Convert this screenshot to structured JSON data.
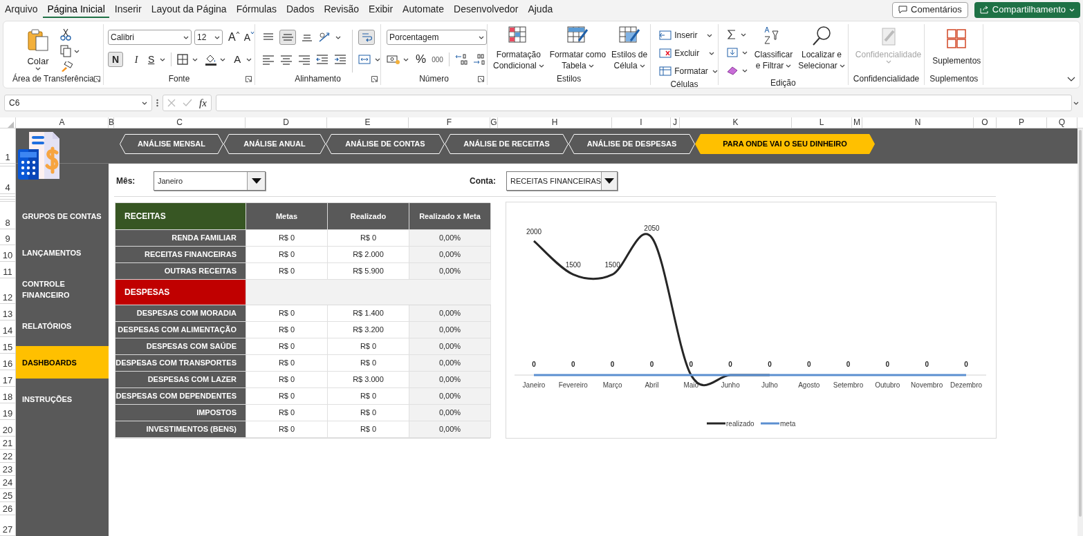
{
  "menu_tabs": [
    {
      "label": "Arquivo",
      "selected": false
    },
    {
      "label": "Página Inicial",
      "selected": true
    },
    {
      "label": "Inserir",
      "selected": false
    },
    {
      "label": "Layout da Página",
      "selected": false
    },
    {
      "label": "Fórmulas",
      "selected": false
    },
    {
      "label": "Dados",
      "selected": false
    },
    {
      "label": "Revisão",
      "selected": false
    },
    {
      "label": "Exibir",
      "selected": false
    },
    {
      "label": "Automate",
      "selected": false
    },
    {
      "label": "Desenvolvedor",
      "selected": false
    },
    {
      "label": "Ajuda",
      "selected": false
    }
  ],
  "header_buttons": {
    "comments": "Comentários",
    "share": "Compartilhamento"
  },
  "ribbon": {
    "clipboard": {
      "label": "Área de Transferência",
      "paste": "Colar"
    },
    "font": {
      "label": "Fonte",
      "family": "Calibri",
      "size": "12",
      "grow": "A",
      "shrink": "A",
      "bold": "N",
      "bold_on": true,
      "italic": "I",
      "underline": "S",
      "font_color": "A"
    },
    "alignment": {
      "label": "Alinhamento",
      "middle_on": true,
      "wrap_on": true
    },
    "number": {
      "label": "Número",
      "format": "Porcentagem",
      "percent": "%",
      "thousands": "000"
    },
    "styles": {
      "label": "Estilos",
      "buttons": [
        {
          "lines": [
            "Formatação",
            "Condicional"
          ]
        },
        {
          "lines": [
            "Formatar como",
            "Tabela"
          ]
        },
        {
          "lines": [
            "Estilos de",
            "Célula"
          ]
        }
      ]
    },
    "cells": {
      "label": "Células",
      "buttons": [
        "Inserir",
        "Excluir",
        "Formatar"
      ]
    },
    "editing": {
      "label": "Edição",
      "buttons": [
        {
          "lines": [
            "Classificar",
            "e Filtrar"
          ]
        },
        {
          "lines": [
            "Localizar e",
            "Selecionar"
          ]
        }
      ]
    },
    "sensitivity": {
      "label": "Confidencialidade",
      "button": "Confidencialidade",
      "disabled": true
    },
    "addins": {
      "label": "Suplementos",
      "button": "Suplementos"
    }
  },
  "formula_bar": {
    "name_box": "C6",
    "function_label": "fx"
  },
  "columns": [
    "A",
    "B",
    "C",
    "D",
    "E",
    "F",
    "G",
    "H",
    "I",
    "J",
    "K",
    "L",
    "M",
    "N",
    "O",
    "P",
    "Q"
  ],
  "rows": [
    "1",
    "4",
    "8",
    "9",
    "10",
    "11",
    "12",
    "13",
    "14",
    "15",
    "16",
    "17",
    "18",
    "19",
    "20",
    "21",
    "22",
    "23",
    "24",
    "25",
    "26",
    "27"
  ],
  "nav_tabs": [
    {
      "label": "ANÁLISE MENSAL",
      "selected": false
    },
    {
      "label": "ANÁLISE ANUAL",
      "selected": false
    },
    {
      "label": "ANÁLISE DE CONTAS",
      "selected": false
    },
    {
      "label": "ANÁLISE DE RECEITAS",
      "selected": false
    },
    {
      "label": "ANÁLISE DE DESPESAS",
      "selected": false
    },
    {
      "label": "PARA ONDE VAI O SEU DINHEIRO",
      "selected": true
    }
  ],
  "sidebar": [
    {
      "label": "GRUPOS DE CONTAS",
      "selected": false
    },
    {
      "label": "LANÇAMENTOS",
      "selected": false
    },
    {
      "label": "CONTROLE FINANCEIRO",
      "selected": false
    },
    {
      "label": "RELATÓRIOS",
      "selected": false
    },
    {
      "label": "DASHBOARDS",
      "selected": true
    },
    {
      "label": "INSTRUÇÕES",
      "selected": false
    }
  ],
  "filters": [
    {
      "label": "Mês:",
      "value": "Janeiro"
    },
    {
      "label": "Conta:",
      "value": "RECEITAS FINANCEIRAS"
    }
  ],
  "table": {
    "columns": [
      "Metas",
      "Realizado",
      "Realizado x Meta"
    ],
    "sections": [
      {
        "title": "RECEITAS",
        "color": "#375623",
        "rows": [
          {
            "label": "RENDA FAMILIAR",
            "cells": [
              "R$ 0",
              "R$ 0",
              "0,00%"
            ]
          },
          {
            "label": "RECEITAS FINANCEIRAS",
            "cells": [
              "R$ 0",
              "R$ 2.000",
              "0,00%"
            ]
          },
          {
            "label": "OUTRAS RECEITAS",
            "cells": [
              "R$ 0",
              "R$ 5.900",
              "0,00%"
            ]
          }
        ]
      },
      {
        "title": "DESPESAS",
        "color": "#c00000",
        "rows": [
          {
            "label": "DESPESAS COM MORADIA",
            "cells": [
              "R$ 0",
              "R$ 1.400",
              "0,00%"
            ]
          },
          {
            "label": "DESPESAS COM ALIMENTAÇÃO",
            "cells": [
              "R$ 0",
              "R$ 3.200",
              "0,00%"
            ]
          },
          {
            "label": "DESPESAS COM SAÚDE",
            "cells": [
              "R$ 0",
              "R$ 0",
              "0,00%"
            ]
          },
          {
            "label": "DESPESAS COM TRANSPORTES",
            "cells": [
              "R$ 0",
              "R$ 0",
              "0,00%"
            ]
          },
          {
            "label": "DESPESAS COM LAZER",
            "cells": [
              "R$ 0",
              "R$ 3.000",
              "0,00%"
            ]
          },
          {
            "label": "DESPESAS COM DEPENDENTES",
            "cells": [
              "R$ 0",
              "R$ 0",
              "0,00%"
            ]
          },
          {
            "label": "IMPOSTOS",
            "cells": [
              "R$ 0",
              "R$ 0",
              "0,00%"
            ]
          },
          {
            "label": "INVESTIMENTOS (BENS)",
            "cells": [
              "R$ 0",
              "R$ 0",
              "0,00%"
            ]
          }
        ]
      }
    ]
  },
  "chart_data": {
    "type": "line",
    "categories": [
      "Janeiro",
      "Fevereiro",
      "Março",
      "Abril",
      "Maio",
      "Junho",
      "Julho",
      "Agosto",
      "Setembro",
      "Outubro",
      "Novembro",
      "Dezembro"
    ],
    "series": [
      {
        "name": "realizado",
        "color": "#262626",
        "values": [
          2000,
          1500,
          1500,
          2050,
          0,
          0,
          0,
          null,
          null,
          null,
          null,
          null
        ],
        "value_labels": [
          "2000",
          "1500",
          "1500",
          "2050",
          null,
          null,
          null,
          null,
          null,
          null,
          null,
          null
        ]
      },
      {
        "name": "meta",
        "color": "#5b8fd0",
        "values": [
          0,
          0,
          0,
          0,
          0,
          0,
          0,
          0,
          0,
          0,
          0,
          0
        ],
        "value_labels": [
          "0",
          "0",
          "0",
          "0",
          "0",
          "0",
          "0",
          "0",
          "0",
          "0",
          "0",
          "0"
        ]
      }
    ],
    "legend": true
  }
}
